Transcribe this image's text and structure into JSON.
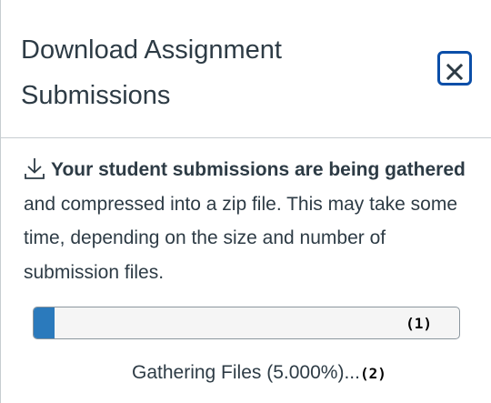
{
  "dialog": {
    "title": "Download Assignment Submissions",
    "close_icon": "close-icon",
    "download_icon": "download-icon",
    "message_bold": "Your student submissions are being gathered",
    "message_rest": " and compressed into a zip file. This may take some time, depending on the size and number of submission files.",
    "progress": {
      "percent": 5.0,
      "marker": "(1)"
    },
    "status_text": "Gathering Files (5.000%)...",
    "status_marker": "(2)"
  },
  "colors": {
    "text": "#2d3b45",
    "close_border": "#0b4ea8",
    "progress_fill": "#2b7abc",
    "divider": "#c7cdd1"
  }
}
